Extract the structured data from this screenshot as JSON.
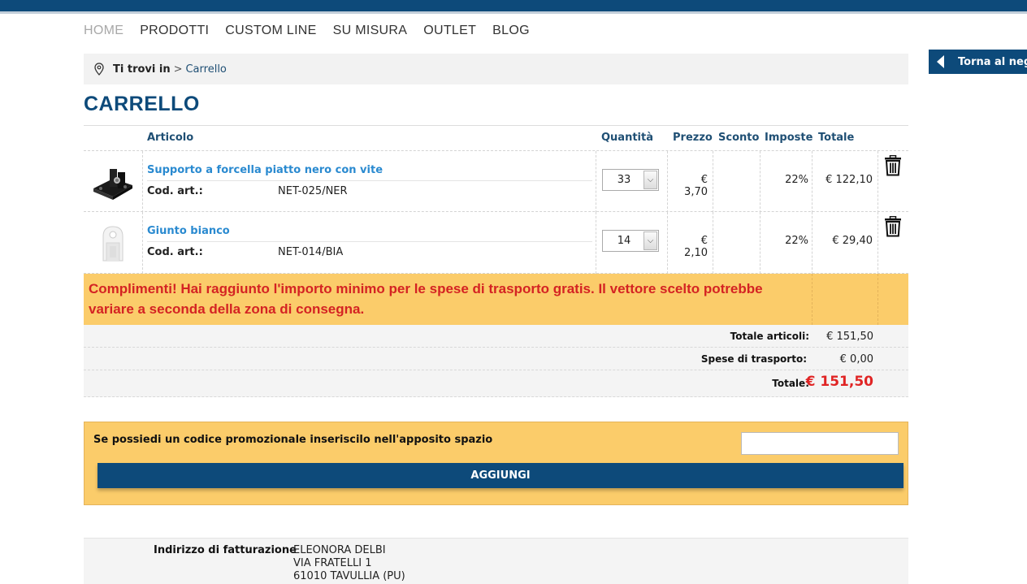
{
  "nav": {
    "items": [
      "HOME",
      "PRODOTTI",
      "CUSTOM LINE",
      "SU MISURA",
      "OUTLET",
      "BLOG"
    ]
  },
  "back_button": "Torna al neg",
  "breadcrumb": {
    "prefix": "Ti trovi in",
    "separator": ">",
    "current": "Carrello"
  },
  "page_title": "CARRELLO",
  "table": {
    "headers": {
      "article": "Articolo",
      "quantity": "Quantità",
      "price": "Prezzo",
      "discount": "Sconto",
      "taxes": "Imposte",
      "total": "Totale"
    },
    "items": [
      {
        "name": "Supporto a forcella piatto nero con vite",
        "code_label": "Cod. art.:",
        "code": "NET-025/NER",
        "quantity": "33",
        "price": "€ 3,70",
        "discount": "",
        "tax": "22%",
        "total": "€ 122,10",
        "image": "black-fork-bracket"
      },
      {
        "name": "Giunto bianco",
        "code_label": "Cod. art.:",
        "code": "NET-014/BIA",
        "quantity": "14",
        "price": "€ 2,10",
        "discount": "",
        "tax": "22%",
        "total": "€ 29,40",
        "image": "white-joint"
      }
    ]
  },
  "notice": "Complimenti! Hai raggiunto l'importo minimo per le spese di trasporto gratis. Il vettore scelto potrebbe variare a seconda della zona di consegna.",
  "totals": {
    "articles_label": "Totale articoli:",
    "articles_value": "€ 151,50",
    "shipping_label": "Spese di trasporto:",
    "shipping_value": "€ 0,00",
    "total_label": "Totale:",
    "total_value": "€ 151,50"
  },
  "promo": {
    "label": "Se possiedi un codice promozionale inseriscilo nell'apposito spazio",
    "input_value": "",
    "button": "AGGIUNGI"
  },
  "billing": {
    "label": "Indirizzo di fatturazione",
    "lines": [
      "ELEONORA DELBI",
      "VIA FRATELLI 1",
      "61010 TAVULLIA (PU)"
    ]
  },
  "colors": {
    "brand_blue": "#0d4a7a",
    "link_blue": "#2a8ad0",
    "notice_bg": "#fbcc6a",
    "alert_red": "#d42323"
  }
}
